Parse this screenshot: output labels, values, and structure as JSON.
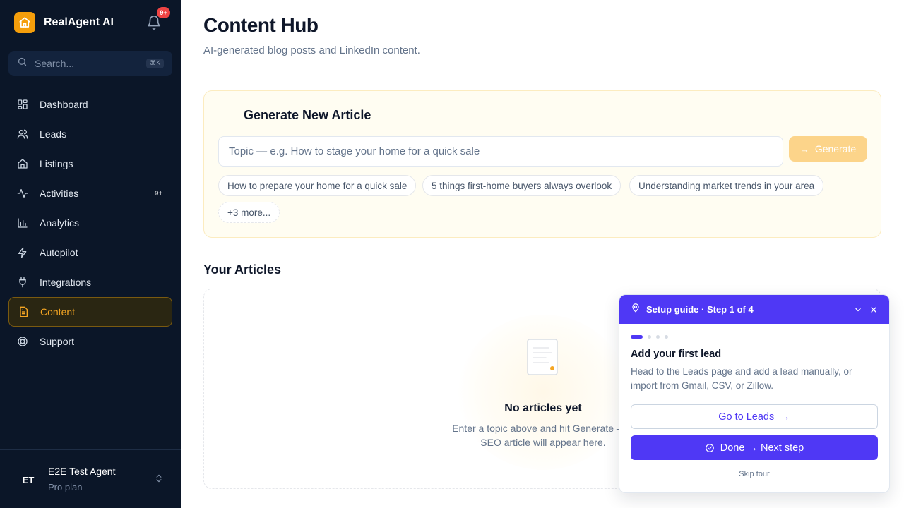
{
  "app": {
    "name": "RealAgent AI",
    "notification_badge": "9+",
    "search_placeholder": "Search...",
    "search_shortcut": "⌘K"
  },
  "sidebar": {
    "items": [
      {
        "label": "Dashboard",
        "icon": "dashboard-grid-icon"
      },
      {
        "label": "Leads",
        "icon": "users-icon"
      },
      {
        "label": "Listings",
        "icon": "home-icon"
      },
      {
        "label": "Activities",
        "icon": "activity-pulse-icon",
        "count": "9+"
      },
      {
        "label": "Analytics",
        "icon": "bar-chart-icon"
      },
      {
        "label": "Autopilot",
        "icon": "lightning-icon"
      },
      {
        "label": "Integrations",
        "icon": "plug-icon"
      },
      {
        "label": "Content",
        "icon": "document-icon",
        "active": true
      },
      {
        "label": "Support",
        "icon": "lifebuoy-icon"
      }
    ],
    "user": {
      "initials": "ET",
      "name": "E2E Test Agent",
      "plan": "Pro plan"
    }
  },
  "header": {
    "title": "Content Hub",
    "subtitle": "AI-generated blog posts and LinkedIn content."
  },
  "generator": {
    "title": "Generate New Article",
    "topic_placeholder": "Topic — e.g. How to stage your home for a quick sale",
    "topic_value": "",
    "generate_label": "Generate",
    "suggestions": [
      "How to prepare your home for a quick sale",
      "5 things first-home buyers always overlook",
      "Understanding market trends in your area"
    ],
    "more_label": "+3 more..."
  },
  "articles": {
    "title": "Your Articles",
    "empty_title": "No articles yet",
    "empty_desc_line1": "Enter a topic above and hit Generate — y",
    "empty_desc_line2": "SEO article will appear here."
  },
  "guide": {
    "header": "Setup guide · Step 1 of 4",
    "step_count": 4,
    "current_step": 1,
    "step_title": "Add your first lead",
    "step_desc": "Head to the Leads page and add a lead manually, or import from Gmail, CSV, or Zillow.",
    "go_label": "Go to Leads",
    "done_label": "Done → Next step",
    "skip_label": "Skip tour"
  },
  "colors": {
    "sidebar_bg": "#0b1628",
    "accent": "#f59e0b",
    "guide_primary": "#4f38f5",
    "badge_red": "#ef4444"
  }
}
